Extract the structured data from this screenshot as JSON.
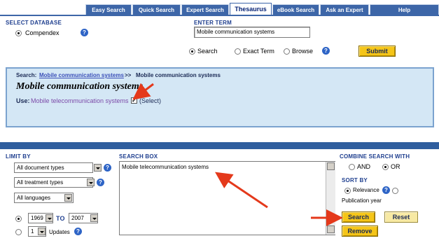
{
  "tabs": [
    {
      "label": "Easy Search"
    },
    {
      "label": "Quick Search"
    },
    {
      "label": "Expert Search"
    },
    {
      "label": "Thesaurus"
    },
    {
      "label": "eBook Search"
    },
    {
      "label": "Ask an Expert"
    },
    {
      "label": "Help"
    }
  ],
  "database": {
    "heading": "SELECT DATABASE",
    "option": "Compendex"
  },
  "enter_term": {
    "heading": "ENTER TERM",
    "value": "Mobile communication systems",
    "options": [
      "Search",
      "Exact Term",
      "Browse"
    ],
    "submit": "Submit"
  },
  "thesaurus": {
    "search_label": "Search:",
    "search_link": "Mobile communication systems",
    "sep": ">>",
    "search_current": "Mobile communication systems",
    "term_title": "Mobile communication systems",
    "use_label": "Use:",
    "use_term": "Mobile telecommunication systems",
    "select_label": "(Select)"
  },
  "limit": {
    "heading": "LIMIT BY",
    "doc_type": "All document types",
    "treatment": "All treatment types",
    "language": "All languages",
    "year_from": "1969",
    "to_label": "TO",
    "year_to": "2007",
    "updates_value": "1",
    "updates_label": "Updates"
  },
  "search_box": {
    "heading": "SEARCH BOX",
    "value": "Mobile telecommunication systems"
  },
  "combine": {
    "heading": "COMBINE SEARCH WITH",
    "and": "AND",
    "or": "OR"
  },
  "sort": {
    "heading": "SORT BY",
    "relevance": "Relevance",
    "pub_year": "Publication year"
  },
  "buttons": {
    "search": "Search",
    "reset": "Reset",
    "remove": "Remove"
  },
  "colors": {
    "tab_blue": "#3d66a8",
    "panel_blue": "#d4e7f5",
    "button_gold": "#f5c518",
    "arrow_red": "#e4391b"
  }
}
